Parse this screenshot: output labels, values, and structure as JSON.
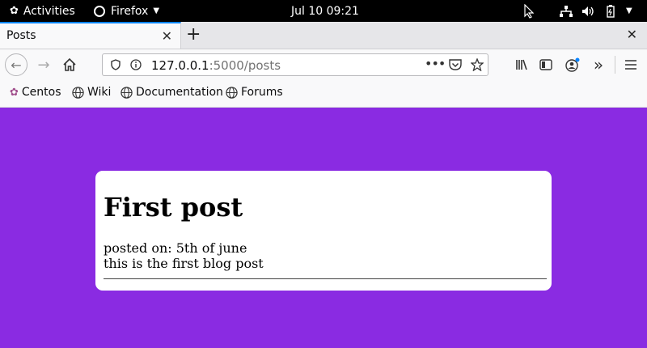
{
  "system_bar": {
    "activities": "Activities",
    "app_name": "Firefox",
    "clock": "Jul 10  09:21"
  },
  "browser": {
    "tab_title": "Posts",
    "url_host": "127.0.0.1",
    "url_rest": ":5000/posts",
    "bookmarks": [
      "Centos",
      "Wiki",
      "Documentation",
      "Forums"
    ]
  },
  "post": {
    "title": "First post",
    "posted_on": "posted on: 5th of june",
    "body": "this is the first blog post"
  },
  "colors": {
    "page_background": "#8a2be2",
    "card_background": "#ffffff"
  }
}
